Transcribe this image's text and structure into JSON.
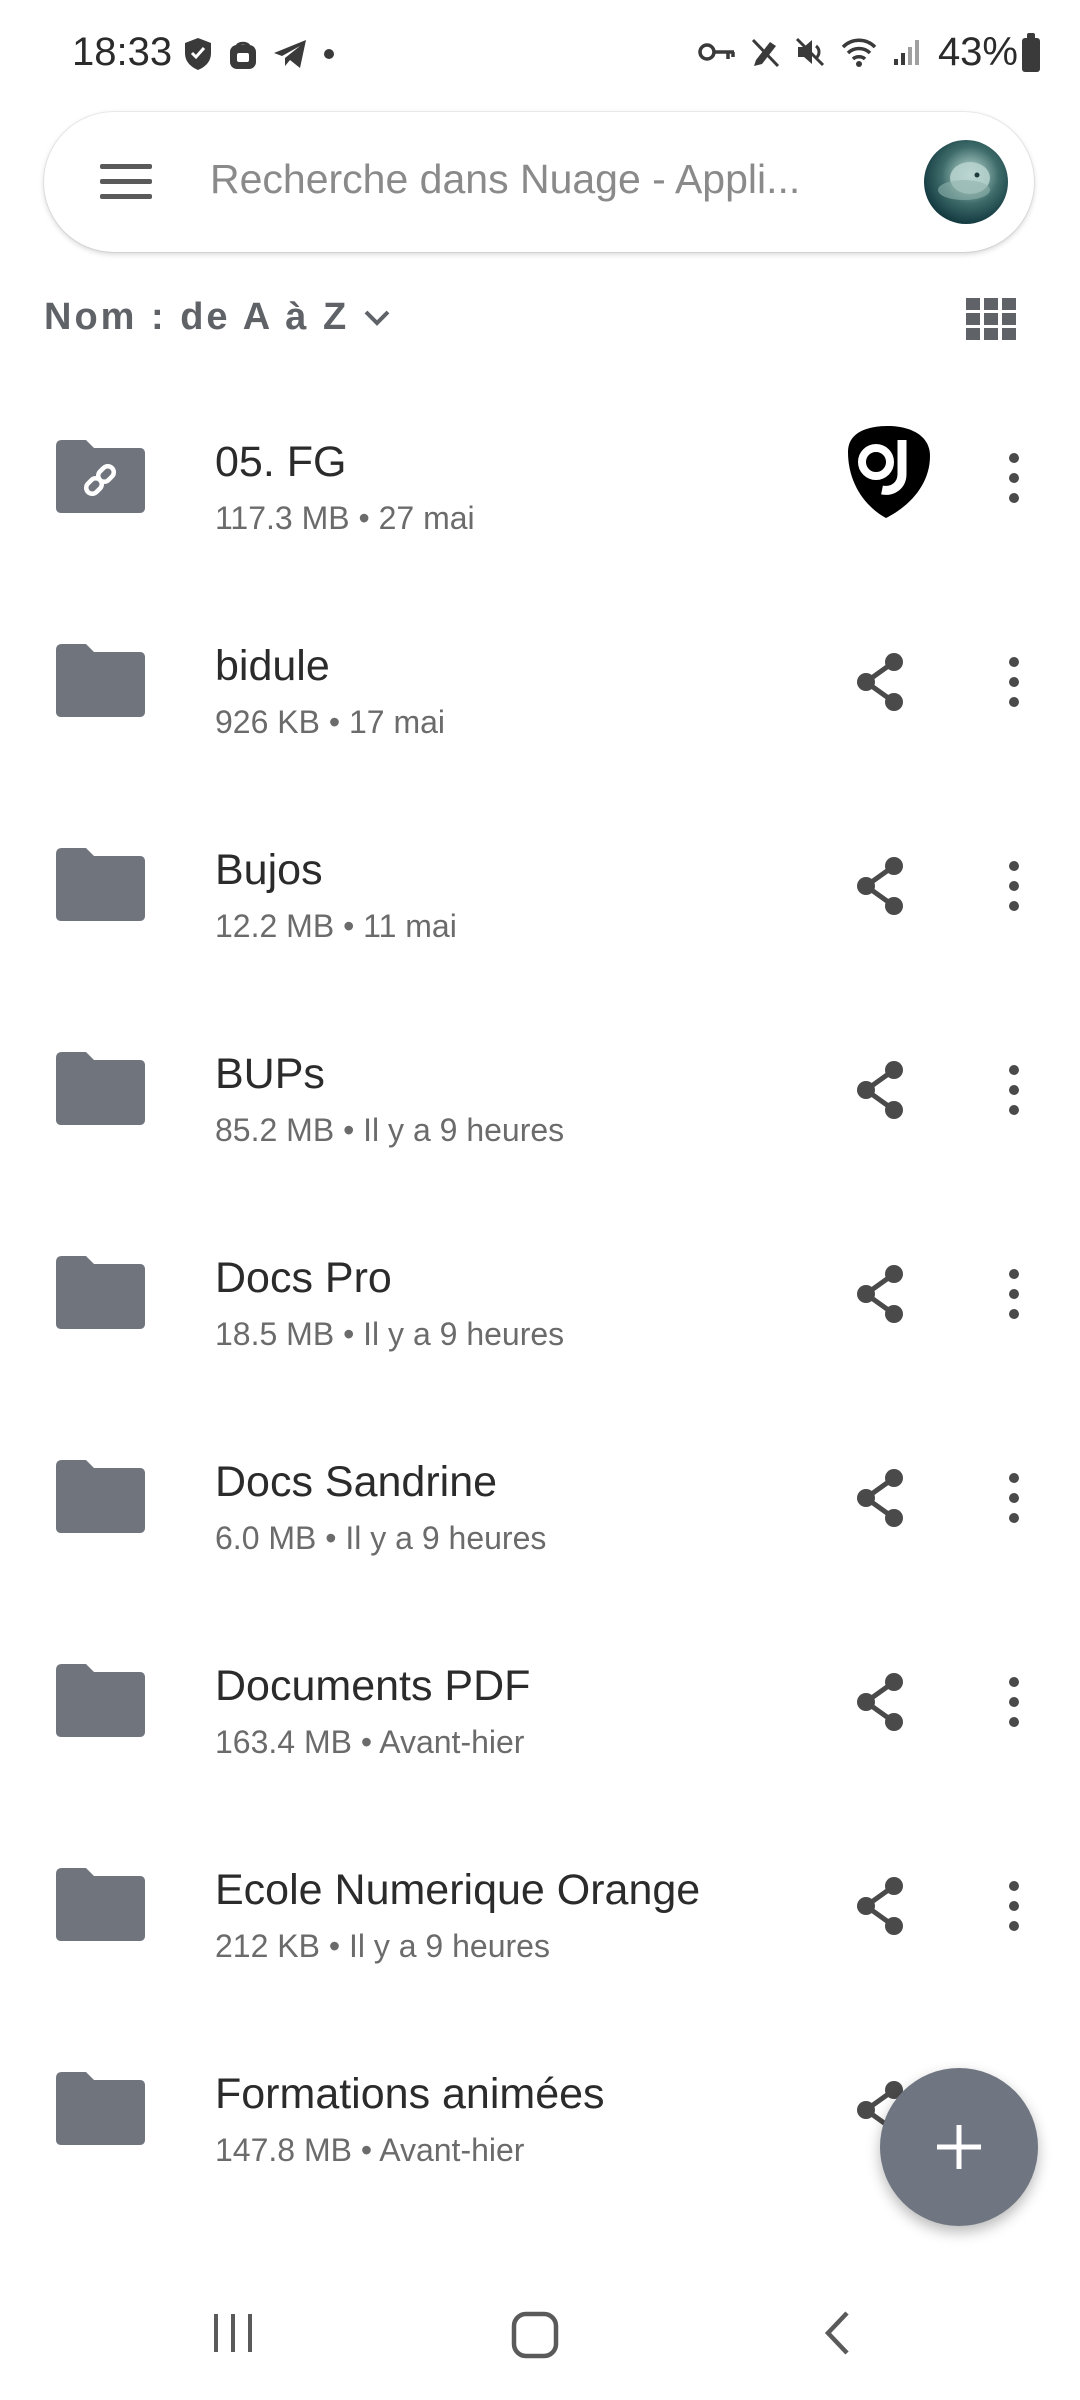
{
  "status_bar": {
    "time": "18:33",
    "battery": "43%",
    "left_icons": [
      "shield-icon",
      "lock-badge-icon",
      "telegram-icon",
      "dot-icon"
    ],
    "right_icons": [
      "key-icon",
      "pen-off-icon",
      "mute-icon",
      "wifi-icon",
      "signal-icon",
      "battery-icon"
    ]
  },
  "search": {
    "placeholder": "Recherche dans Nuage - Appli..."
  },
  "sort": {
    "label": "Nom : de A à Z"
  },
  "colors": {
    "folder": "#70757d",
    "fab": "#6f7681",
    "text_primary": "#2b2b2b",
    "text_secondary": "#6b6b6b"
  },
  "files": [
    {
      "name": "05. FG",
      "meta": "117.3 MB • 27 mai",
      "icon": "shared-folder-link-icon",
      "action": "owner-avatar"
    },
    {
      "name": "bidule",
      "meta": "926 KB • 17 mai",
      "icon": "folder-icon",
      "action": "share"
    },
    {
      "name": "Bujos",
      "meta": "12.2 MB • 11 mai",
      "icon": "folder-icon",
      "action": "share"
    },
    {
      "name": "BUPs",
      "meta": "85.2 MB • Il y a 9 heures",
      "icon": "folder-icon",
      "action": "share"
    },
    {
      "name": "Docs Pro",
      "meta": "18.5 MB • Il y a 9 heures",
      "icon": "folder-icon",
      "action": "share"
    },
    {
      "name": "Docs Sandrine",
      "meta": "6.0 MB • Il y a 9 heures",
      "icon": "folder-icon",
      "action": "share"
    },
    {
      "name": "Documents PDF",
      "meta": "163.4 MB • Avant-hier",
      "icon": "folder-icon",
      "action": "share"
    },
    {
      "name": "Ecole Numerique Orange",
      "meta": "212 KB • Il y a 9 heures",
      "icon": "folder-icon",
      "action": "share"
    },
    {
      "name": "Formations animées",
      "meta": "147.8 MB • Avant-hier",
      "icon": "folder-icon",
      "action": "share"
    }
  ]
}
